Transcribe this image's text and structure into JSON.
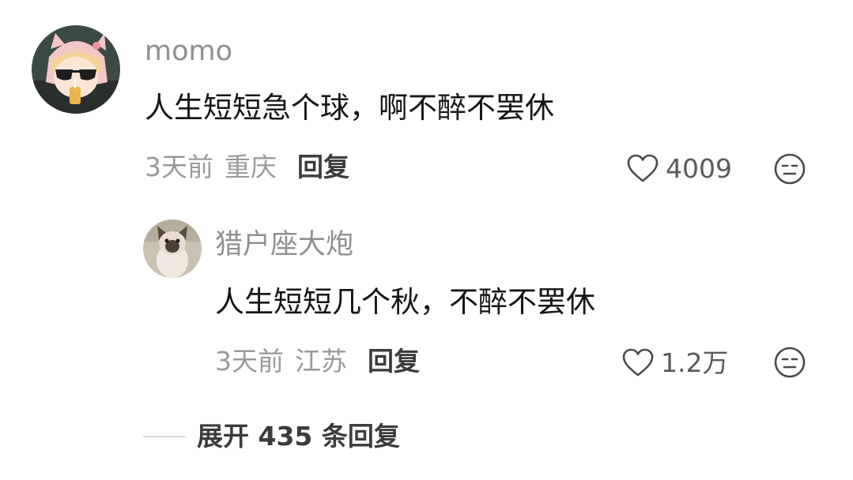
{
  "comment": {
    "username": "momo",
    "text": "人生短短急个球，啊不醉不罢休",
    "time": "3天前",
    "location": "重庆",
    "reply_label": "回复",
    "like_count": "4009",
    "avatar_icon": "anime-girl-avatar"
  },
  "reply": {
    "username": "猎户座大炮",
    "text": "人生短短几个秋，不醉不罢休",
    "time": "3天前",
    "location": "江苏",
    "reply_label": "回复",
    "like_count": "1.2万",
    "avatar_icon": "cat-avatar"
  },
  "expand": {
    "label": "展开 435 条回复"
  },
  "colors": {
    "username": "#8f8f94",
    "text": "#161616",
    "meta": "#9a9a9e",
    "reply_label": "#3c3c3c",
    "icon": "#4a4a4e"
  }
}
